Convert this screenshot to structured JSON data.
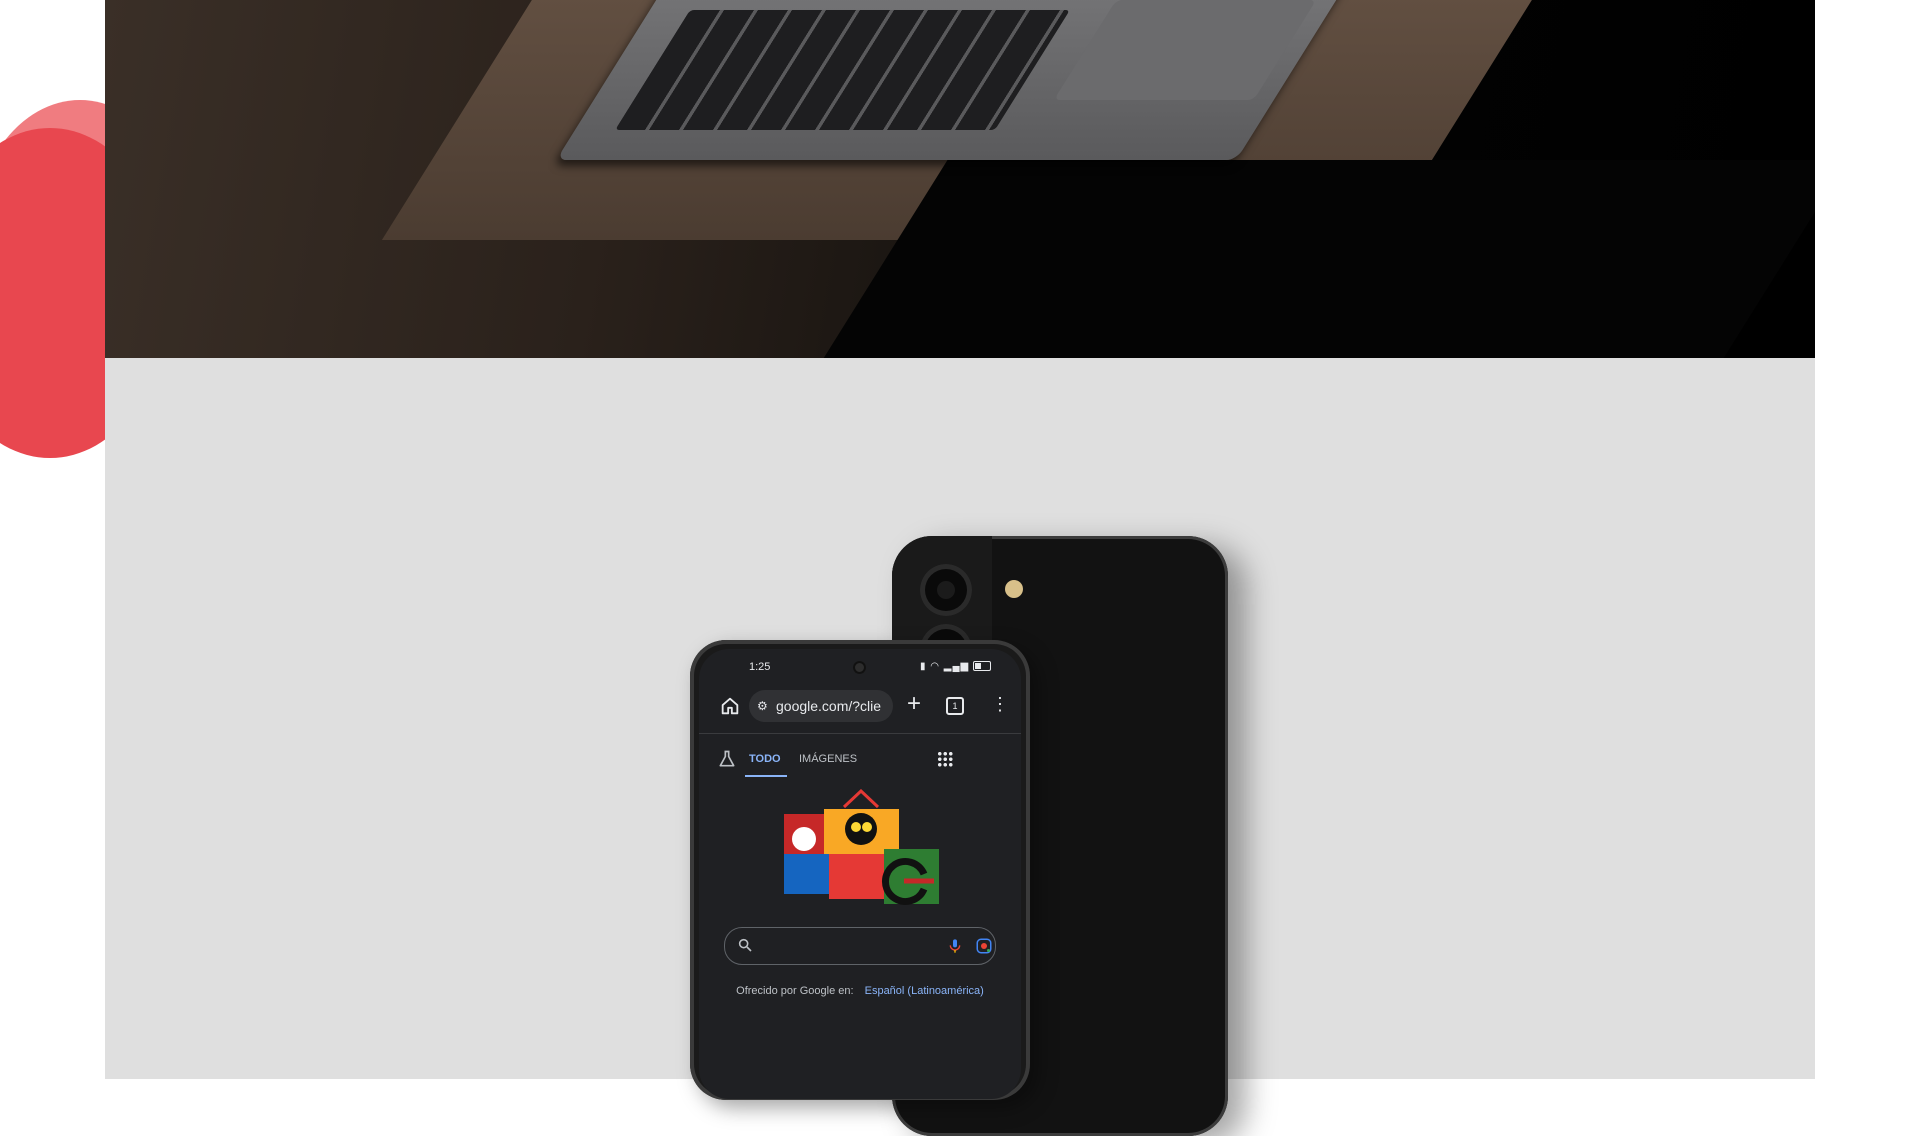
{
  "phone": {
    "status_time": "1:25",
    "url": "google.com/?clie",
    "tab_count": "1",
    "tabs": [
      "TODO",
      "IMÁGENES"
    ],
    "offered_label": "Ofrecido por Google en:",
    "offered_language": "Español (Latinoamérica)"
  },
  "icons": {
    "home": "home-icon",
    "tune": "site-settings-icon",
    "new_tab": "plus-icon",
    "tabs": "tab-switcher-icon",
    "menu": "kebab-menu-icon",
    "labs": "flask-icon",
    "apps": "apps-grid-icon",
    "search": "search-icon",
    "voice": "microphone-icon",
    "lens": "google-lens-icon"
  },
  "colors": {
    "accent_red": "#e8474f",
    "section_gray": "#dfdfdf",
    "link_blue": "#8ab4f8"
  }
}
